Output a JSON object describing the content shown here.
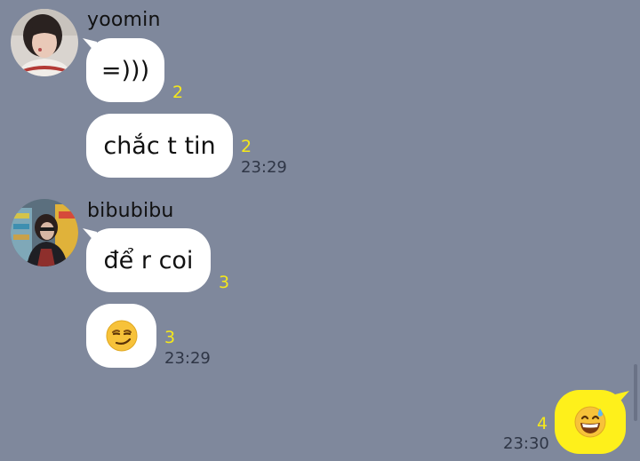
{
  "colors": {
    "background": "#7f889c",
    "incoming_bubble": "#ffffff",
    "outgoing_bubble": "#fef01b",
    "unread_count": "#f5e81a",
    "timestamp": "#2f3646"
  },
  "messages": {
    "group1": {
      "sender": "yoomin",
      "avatar_icon": "profile-photo",
      "items": [
        {
          "text": "=)))",
          "unread": "2"
        },
        {
          "text": "chắc t tin",
          "unread": "2",
          "time": "23:29"
        }
      ]
    },
    "group2": {
      "sender": "bibubibu",
      "avatar_icon": "profile-photo",
      "items": [
        {
          "text": "để r coi",
          "unread": "3"
        },
        {
          "emoji": "smirking-face",
          "unread": "3",
          "time": "23:29"
        }
      ]
    },
    "outgoing": {
      "emoji": "grinning-face-with-sweat",
      "unread": "4",
      "time": "23:30"
    }
  }
}
